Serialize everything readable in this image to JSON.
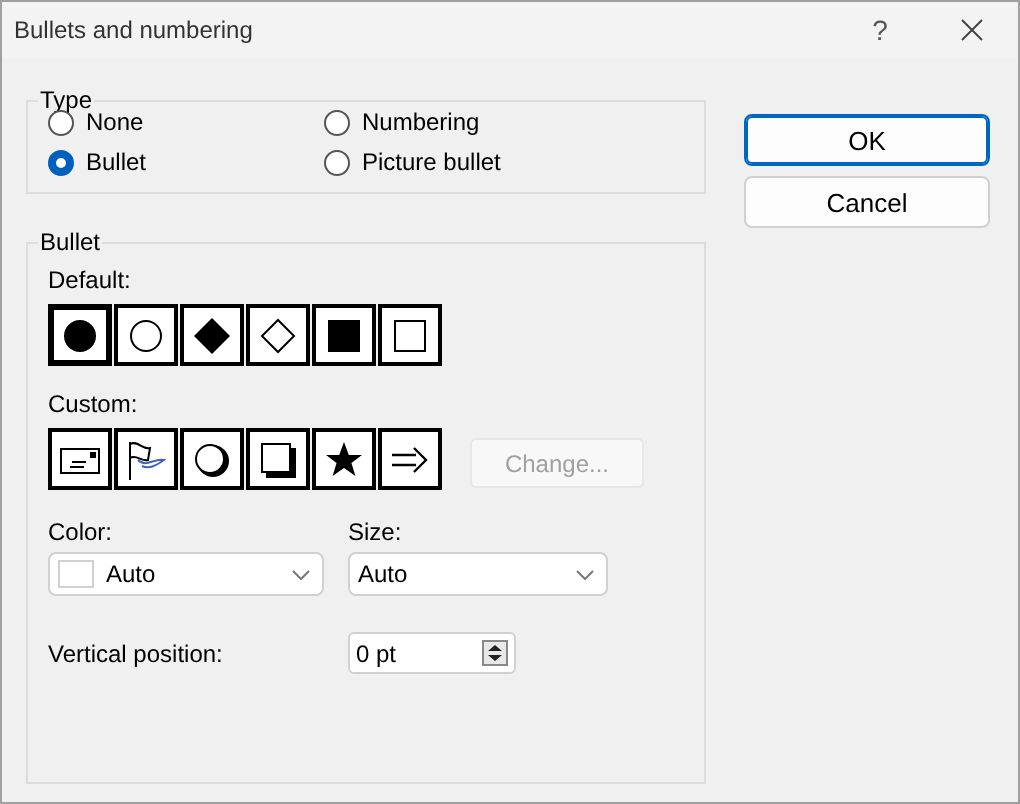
{
  "window": {
    "title": "Bullets and numbering",
    "help": "?"
  },
  "type_group": {
    "legend": "Type",
    "options": [
      {
        "label": "None",
        "selected": false
      },
      {
        "label": "Numbering",
        "selected": false
      },
      {
        "label": "Bullet",
        "selected": true
      },
      {
        "label": "Picture bullet",
        "selected": false
      }
    ]
  },
  "bullet_group": {
    "legend": "Bullet",
    "default_label": "Default:",
    "default_bullets": [
      {
        "kind": "disc",
        "selected": true
      },
      {
        "kind": "circle",
        "selected": false
      },
      {
        "kind": "diamond",
        "selected": false
      },
      {
        "kind": "diamond-outline",
        "selected": false
      },
      {
        "kind": "square",
        "selected": false
      },
      {
        "kind": "square-outline",
        "selected": false
      }
    ],
    "custom_label": "Custom:",
    "custom_bullets": [
      {
        "kind": "envelope",
        "selected": false
      },
      {
        "kind": "flag",
        "selected": false
      },
      {
        "kind": "shadow-circle",
        "selected": false
      },
      {
        "kind": "shadow-square",
        "selected": false
      },
      {
        "kind": "star",
        "selected": false
      },
      {
        "kind": "arrow",
        "selected": false
      }
    ],
    "change_button": {
      "label": "Change...",
      "disabled": true
    },
    "color": {
      "label": "Color:",
      "value": "Auto"
    },
    "size": {
      "label": "Size:",
      "value": "Auto"
    },
    "vertical_position": {
      "label": "Vertical position:",
      "value": "0 pt"
    }
  },
  "buttons": [
    {
      "label": "OK",
      "default": true
    },
    {
      "label": "Cancel",
      "default": false
    }
  ]
}
